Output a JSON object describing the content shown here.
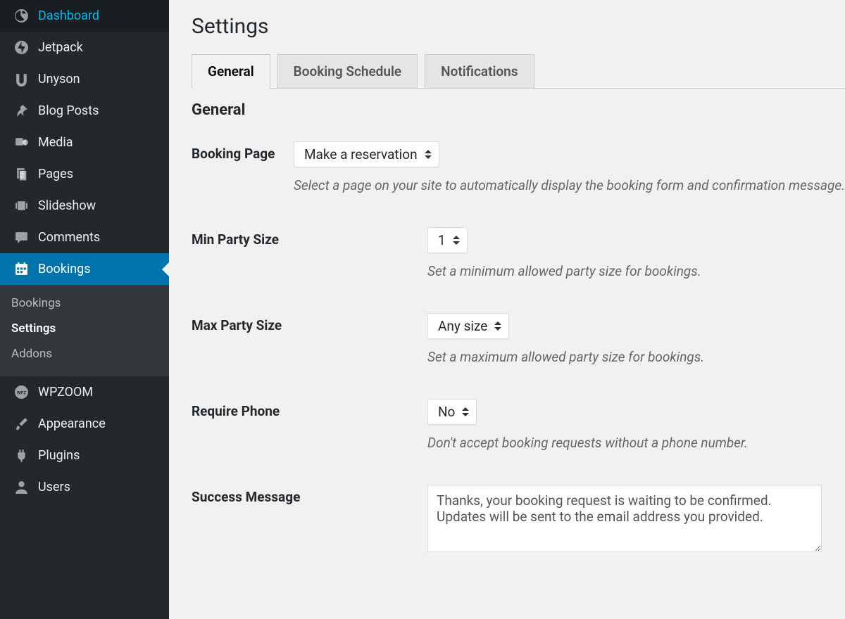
{
  "sidebar": {
    "items": [
      {
        "label": "Dashboard",
        "icon": "dashboard"
      },
      {
        "label": "Jetpack",
        "icon": "jetpack"
      },
      {
        "label": "Unyson",
        "icon": "unyson"
      },
      {
        "label": "Blog Posts",
        "icon": "pin"
      },
      {
        "label": "Media",
        "icon": "media"
      },
      {
        "label": "Pages",
        "icon": "pages"
      },
      {
        "label": "Slideshow",
        "icon": "slideshow"
      },
      {
        "label": "Comments",
        "icon": "comments"
      },
      {
        "label": "Bookings",
        "icon": "calendar",
        "active": true
      },
      {
        "label": "WPZOOM",
        "icon": "wpzoom"
      },
      {
        "label": "Appearance",
        "icon": "brush"
      },
      {
        "label": "Plugins",
        "icon": "plugin"
      },
      {
        "label": "Users",
        "icon": "user"
      }
    ],
    "submenu": {
      "after": 8,
      "items": [
        {
          "label": "Bookings"
        },
        {
          "label": "Settings",
          "current": true
        },
        {
          "label": "Addons"
        }
      ]
    }
  },
  "page": {
    "title": "Settings",
    "tabs": [
      {
        "label": "General",
        "active": true
      },
      {
        "label": "Booking Schedule"
      },
      {
        "label": "Notifications"
      }
    ],
    "section_title": "General",
    "fields": {
      "booking_page": {
        "label": "Booking Page",
        "value": "Make a reservation",
        "description": "Select a page on your site to automatically display the booking form and confirmation message."
      },
      "min_party": {
        "label": "Min Party Size",
        "value": "1",
        "description": "Set a minimum allowed party size for bookings."
      },
      "max_party": {
        "label": "Max Party Size",
        "value": "Any size",
        "description": "Set a maximum allowed party size for bookings."
      },
      "require_phone": {
        "label": "Require Phone",
        "value": "No",
        "description": "Don't accept booking requests without a phone number."
      },
      "success_message": {
        "label": "Success Message",
        "value": "Thanks, your booking request is waiting to be confirmed. Updates will be sent to the email address you provided."
      }
    }
  }
}
